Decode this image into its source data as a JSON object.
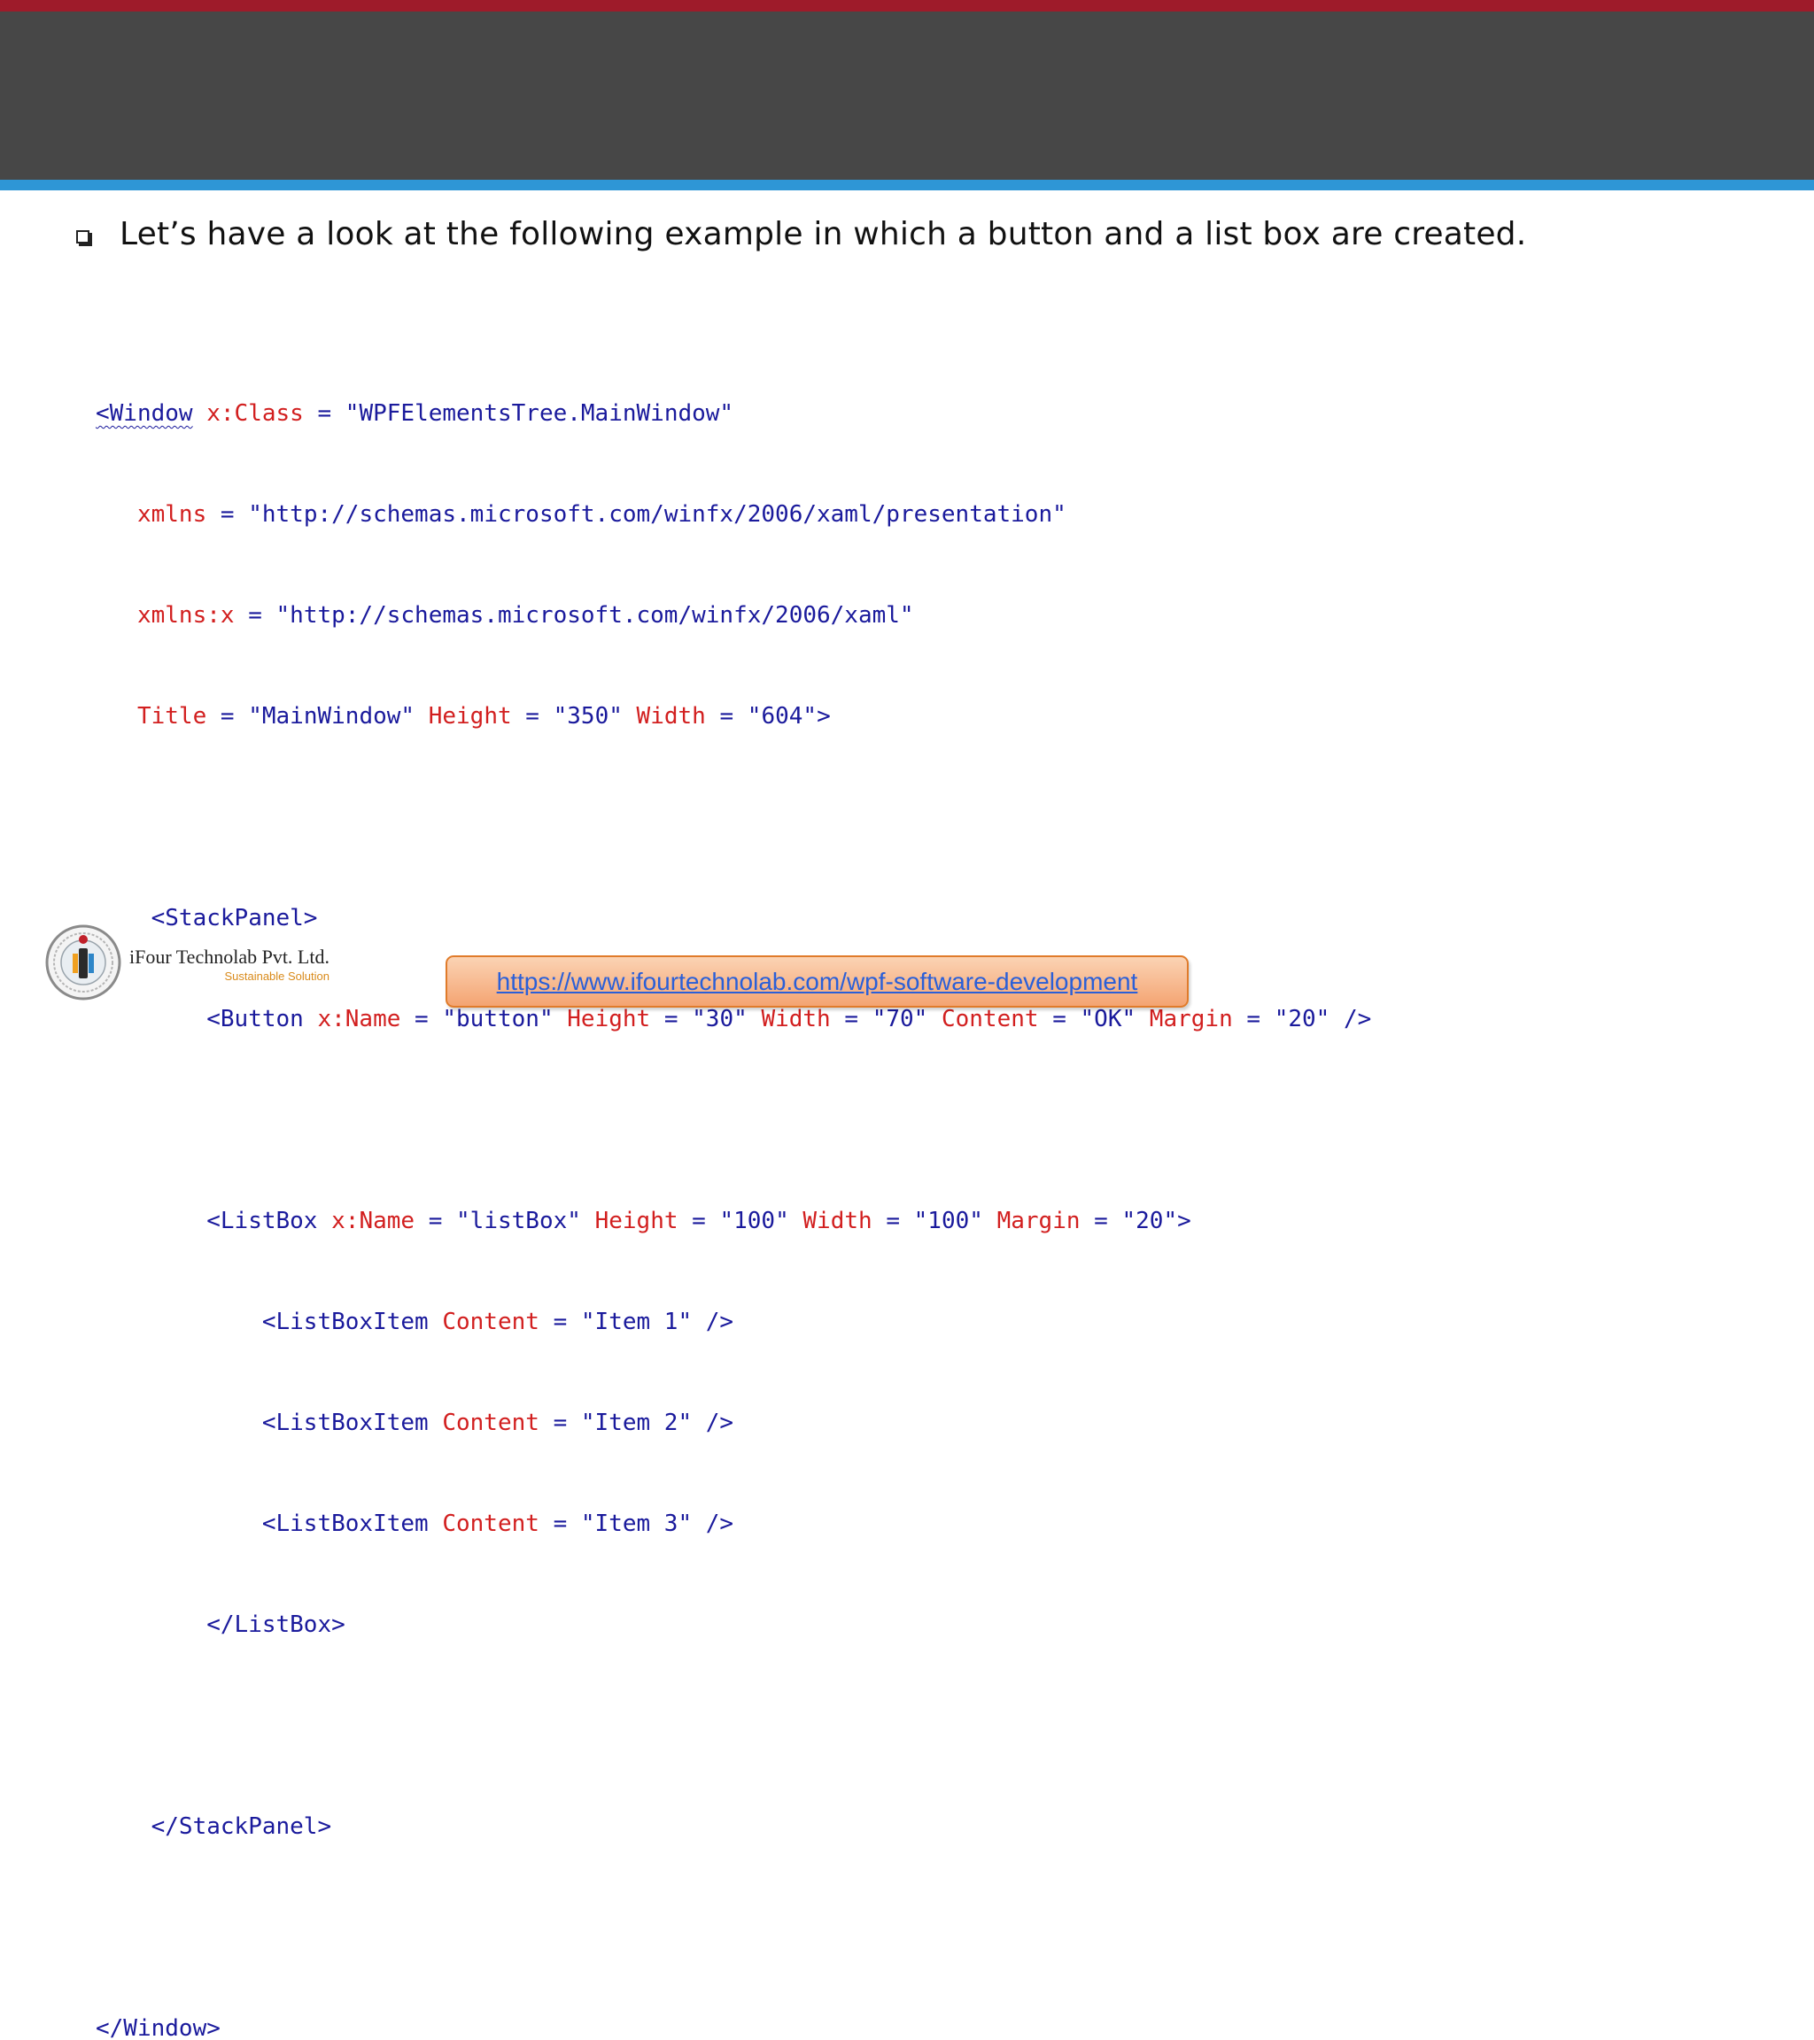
{
  "colors": {
    "top_stripe": "#9e1b2a",
    "header_band": "#474747",
    "blue_stripe": "#2e96d6",
    "code_tag": "#1a1a9c",
    "code_attr": "#d21f1f",
    "link": "#2a5fd8"
  },
  "bullet": {
    "icon": "square-bullet-icon",
    "text": "Let’s have a look at the following example in which a button and a list box are created."
  },
  "code": {
    "l1": {
      "open": "<Window",
      "ns": "x:",
      "attr": "Class",
      "eq": " = ",
      "val": "\"WPFElementsTree.MainWindow\""
    },
    "l2": {
      "attr": "xmlns",
      "eq": " = ",
      "val": "\"http://schemas.microsoft.com/winfx/2006/xaml/presentation\""
    },
    "l3": {
      "attr": "xmlns:x",
      "eq": " = ",
      "val": "\"http://schemas.microsoft.com/winfx/2006/xaml\""
    },
    "l4": {
      "a1": "Title",
      "eq1": " = ",
      "v1": "\"MainWindow\"",
      "a2": "Height",
      "eq2": " = ",
      "v2": "\"350\"",
      "a3": "Width",
      "eq3": " = ",
      "v3": "\"604\">"
    },
    "l6": {
      "tag": "<StackPanel>"
    },
    "l7": {
      "tag": "<Button",
      "ns": "x:",
      "a1": "Name",
      "eq1": " = ",
      "v1": "\"button\"",
      "a2": "Height",
      "eq2": " = ",
      "v2": "\"30\"",
      "a3": "Width",
      "eq3": " = ",
      "v3": "\"70\"",
      "a4": "Content",
      "eq4": " = ",
      "v4": "\"OK\"",
      "a5": "Margin",
      "eq5": " = ",
      "v5": "\"20\" />"
    },
    "l9": {
      "tag": "<ListBox",
      "ns": "x:",
      "a1": "Name",
      "eq1": " = ",
      "v1": "\"listBox\"",
      "a2": "Height",
      "eq2": " = ",
      "v2": "\"100\"",
      "a3": "Width",
      "eq3": " = ",
      "v3": "\"100\"",
      "a4": "Margin",
      "eq4": " = ",
      "v4": "\"20\">"
    },
    "items": [
      {
        "tag": "<ListBoxItem",
        "attr": "Content",
        "eq": " = ",
        "val": "\"Item 1\" />"
      },
      {
        "tag": "<ListBoxItem",
        "attr": "Content",
        "eq": " = ",
        "val": "\"Item 2\" />"
      },
      {
        "tag": "<ListBoxItem",
        "attr": "Content",
        "eq": " = ",
        "val": "\"Item 3\" />"
      }
    ],
    "l13": {
      "tag": "</ListBox>"
    },
    "l15": {
      "tag": "</StackPanel>"
    },
    "l17": {
      "tag": "</Window>"
    }
  },
  "footer": {
    "logo_icon": "ifour-logo-icon",
    "company_name": "iFour Technolab Pvt. Ltd.",
    "tagline": "Sustainable Solution",
    "link": "https://www.ifourtechnolab.com/wpf-software-development"
  }
}
